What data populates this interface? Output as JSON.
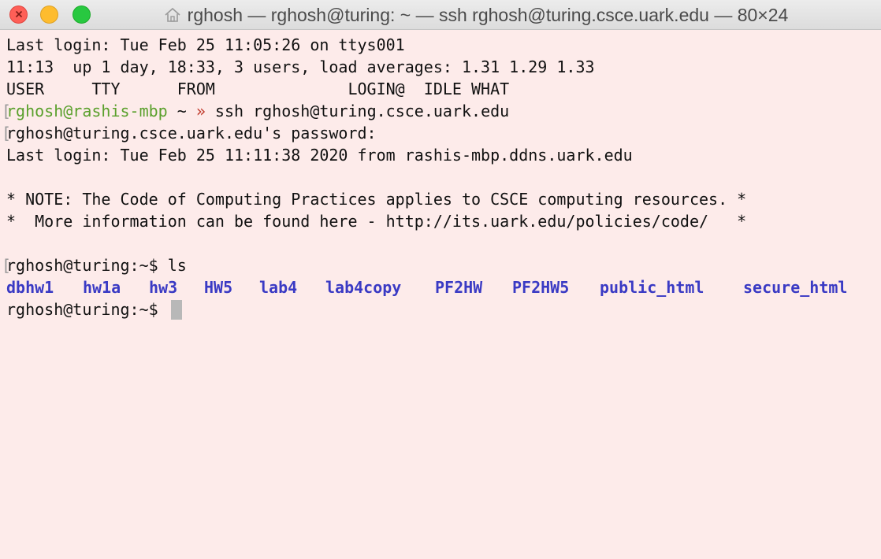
{
  "window": {
    "title": "rghosh — rghosh@turing: ~ — ssh rghosh@turing.csce.uark.edu — 80×24",
    "title_icon": "home-icon"
  },
  "terminal": {
    "lines": [
      "Last login: Tue Feb 25 11:05:26 on ttys001",
      "11:13  up 1 day, 18:33, 3 users, load averages: 1.31 1.29 1.33",
      "USER     TTY      FROM              LOGIN@  IDLE WHAT"
    ],
    "local_prompt_user": "rghosh@rashis-mbp",
    "local_prompt_dir": " ~ ",
    "local_prompt_arrow": "»",
    "local_command": " ssh rghosh@turing.csce.uark.edu",
    "password_prompt": "rghosh@turing.csce.uark.edu's password:",
    "remote_last_login": "Last login: Tue Feb 25 11:11:38 2020 from rashis-mbp.ddns.uark.edu",
    "note_line_1": "* NOTE: The Code of Computing Practices applies to CSCE computing resources. *",
    "note_line_2": "*  More information can be found here - http://its.uark.edu/policies/code/   *",
    "remote_prompt_1": "rghosh@turing:~$ ls",
    "ls_output": [
      "dbhw1",
      "hw1a",
      "hw3",
      "HW5",
      "lab4",
      "lab4copy",
      "PF2HW",
      "PF2HW5",
      "public_html",
      "secure_html"
    ],
    "remote_prompt_2": "rghosh@turing:~$ "
  },
  "colors": {
    "background": "#fdebea",
    "prompt_green": "#5aa02c",
    "arrow_red": "#c0392b",
    "directory_blue": "#3a3ac4"
  }
}
